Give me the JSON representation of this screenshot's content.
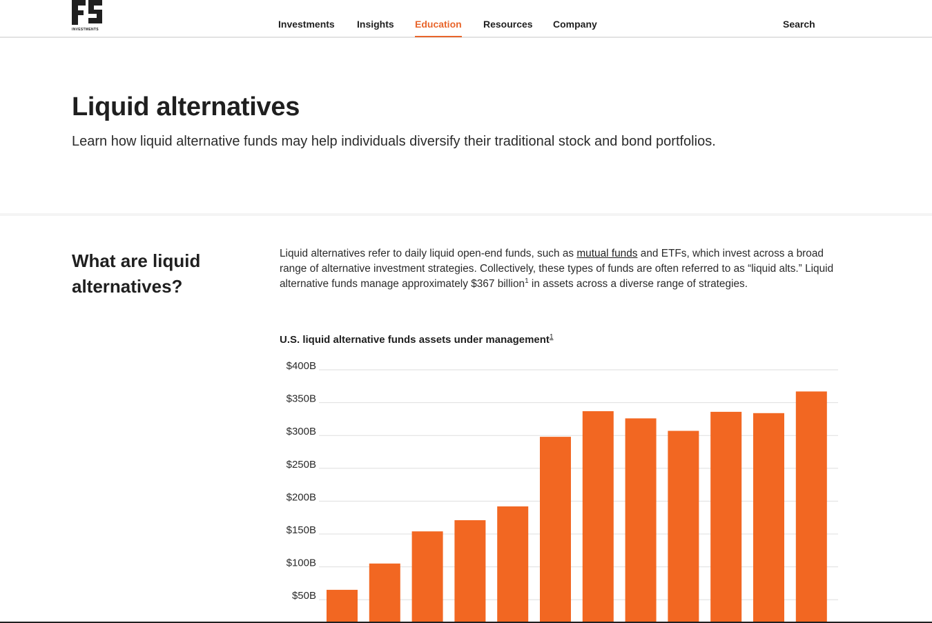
{
  "brand": {
    "logo_mark": "FS",
    "logo_subtext": "INVESTMENTS",
    "accent_color": "#e8652b"
  },
  "nav": {
    "items": [
      {
        "label": "Investments",
        "active": false
      },
      {
        "label": "Insights",
        "active": false
      },
      {
        "label": "Education",
        "active": true
      },
      {
        "label": "Resources",
        "active": false
      },
      {
        "label": "Company",
        "active": false
      }
    ],
    "search_label": "Search"
  },
  "hero": {
    "title": "Liquid alternatives",
    "subtitle": "Learn how liquid alternative funds may help individuals diversify their traditional stock and bond portfolios."
  },
  "section": {
    "heading": "What are liquid alternatives?",
    "body_before_link": "Liquid alternatives refer to daily liquid open-end funds, such as ",
    "link_text": "mutual funds",
    "body_after_link": " and ETFs, which invest across a broad range of alternative investment strategies. Collectively, these types of funds are often referred to as “liquid alts.” Liquid alternative funds manage approximately $367 billion",
    "footnote": "1",
    "body_end": " in assets across a diverse range of strategies."
  },
  "chart_data": {
    "type": "bar",
    "title": "U.S. liquid alternative funds assets under management",
    "title_footnote": "1",
    "ylabel": "",
    "xlabel": "",
    "y_ticks": [
      "$50B",
      "$100B",
      "$150B",
      "$200B",
      "$250B",
      "$300B",
      "$350B",
      "$400B"
    ],
    "ylim": [
      0,
      400
    ],
    "grid": true,
    "bar_color": "#f26722",
    "values": [
      65,
      105,
      154,
      171,
      192,
      298,
      337,
      326,
      307,
      336,
      334,
      367
    ]
  }
}
